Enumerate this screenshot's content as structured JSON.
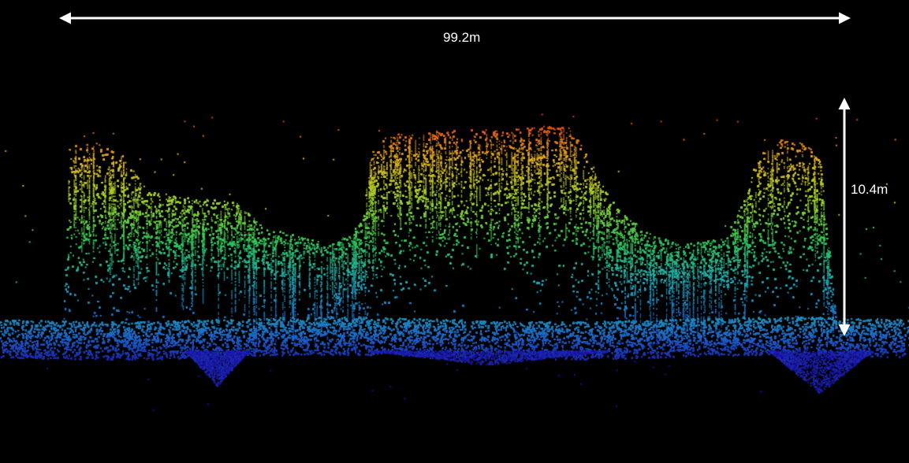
{
  "background": "#000000",
  "annotation_color": "#ffffff",
  "measurements": {
    "width_label": "99.2m",
    "height_label": "10.4m"
  },
  "colormap": [
    "#1a0aa0",
    "#1e62c8",
    "#1fa8b8",
    "#2fc25a",
    "#9fd22a",
    "#e0b020",
    "#d83a12"
  ]
}
